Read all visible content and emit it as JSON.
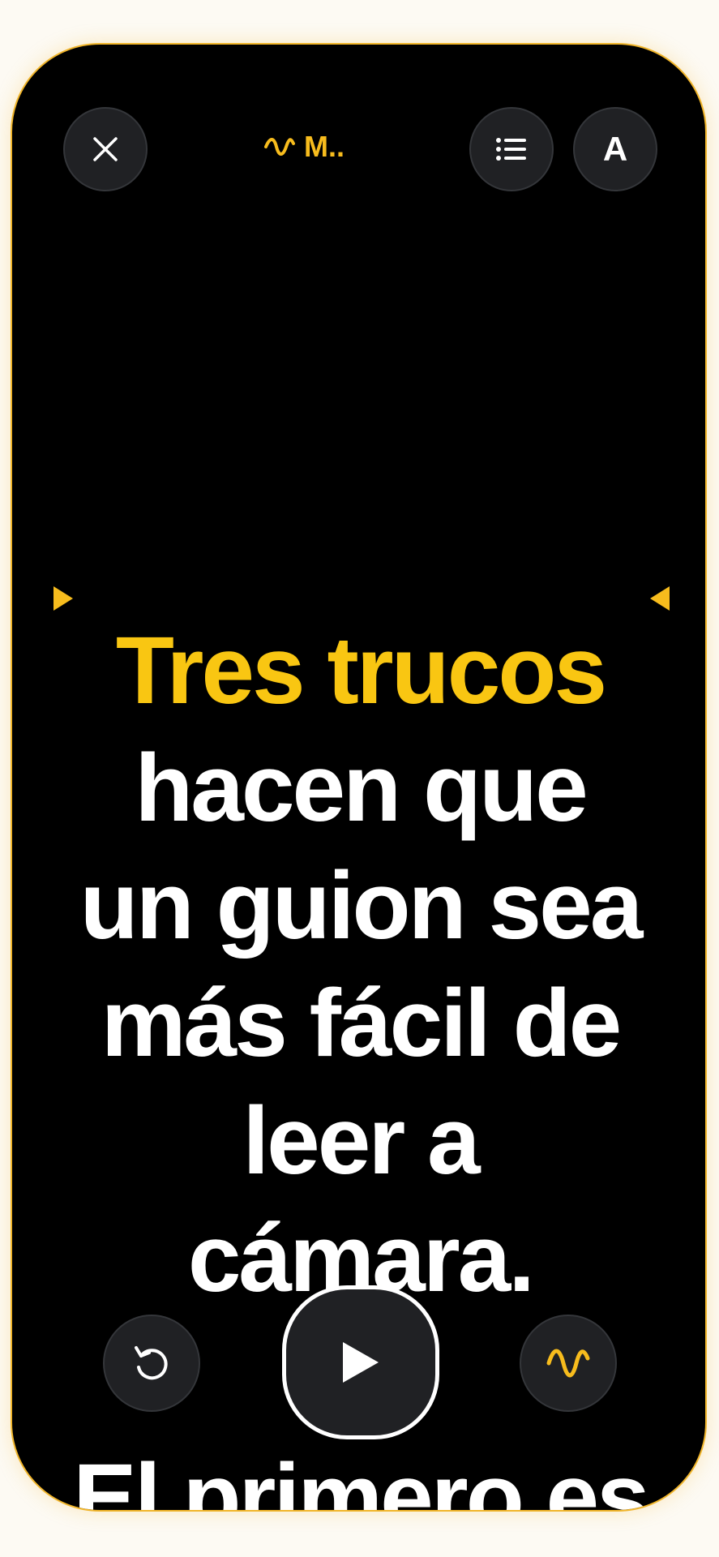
{
  "header": {
    "title": "M..",
    "font_button_label": "A",
    "icons": {
      "close": "close-icon",
      "title": "waveform-icon",
      "list": "list-icon"
    }
  },
  "script": {
    "highlight_text": "Tres trucos",
    "lines": [
      "hacen que",
      "un guion sea",
      "más fácil de",
      "leer a",
      "cámara."
    ],
    "next_line": "El primero es"
  },
  "controls": {
    "icons": {
      "restart": "restart-icon",
      "play": "play-icon",
      "voice": "waveform-icon"
    }
  },
  "colors": {
    "accent": "#f9c612",
    "background": "#000000",
    "button": "#202124",
    "frame": "#f1b52a"
  }
}
